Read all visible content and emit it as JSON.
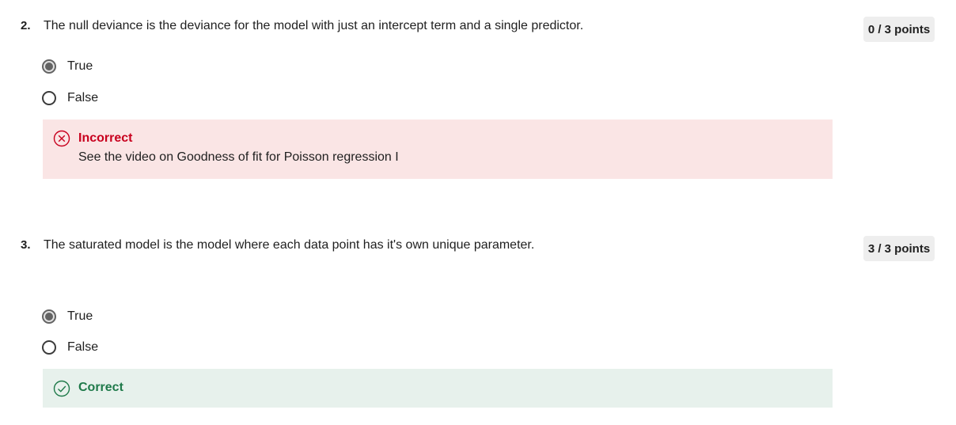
{
  "colors": {
    "incorrect_text": "#c8001e",
    "incorrect_bg": "#fae5e5",
    "correct_text": "#1f7a4a",
    "correct_bg": "#e7f1ec",
    "badge_bg": "#eeeeee"
  },
  "questions": [
    {
      "number": "2.",
      "text": "The null deviance is the deviance for the model with just an intercept term and a single predictor.",
      "points": "0 / 3 points",
      "options": [
        {
          "label": "True",
          "selected": true
        },
        {
          "label": "False",
          "selected": false
        }
      ],
      "feedback": {
        "status": "Incorrect",
        "icon": "x-circle-icon",
        "detail": "See the video on Goodness of fit for Poisson regression I"
      }
    },
    {
      "number": "3.",
      "text": "The saturated model is the model where each data point has it's own unique parameter.",
      "points": "3 / 3 points",
      "options": [
        {
          "label": "True",
          "selected": true
        },
        {
          "label": "False",
          "selected": false
        }
      ],
      "feedback": {
        "status": "Correct",
        "icon": "check-circle-icon"
      }
    }
  ]
}
